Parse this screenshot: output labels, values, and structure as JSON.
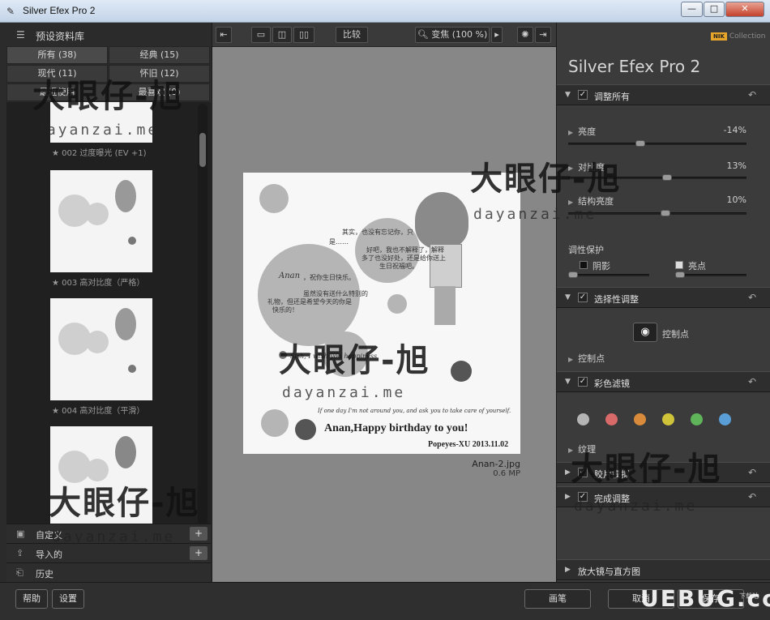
{
  "window": {
    "title": "Silver Efex Pro 2",
    "min": "0",
    "max": "1",
    "close": "r"
  },
  "library": {
    "title": "预设资料库",
    "tabs": [
      {
        "label": "所有 (38)"
      },
      {
        "label": "经典 (15)"
      },
      {
        "label": "现代 (11)"
      },
      {
        "label": "怀旧 (12)"
      },
      {
        "label": "最近使用"
      },
      {
        "label": "最喜欢 (0)"
      }
    ],
    "presets": [
      {
        "caption": "★ 002 过度曝光 (EV +1)"
      },
      {
        "caption": "★ 003 高对比度（严格）"
      },
      {
        "caption": "★ 004 高对比度（平滑）"
      },
      {
        "caption": ""
      }
    ],
    "rows": [
      {
        "label": "自定义",
        "plus": "+"
      },
      {
        "label": "导入的",
        "plus": "+"
      },
      {
        "label": "历史"
      }
    ]
  },
  "toolbar": {
    "compare_label": "比较",
    "zoom_label": "变焦 (100 %)"
  },
  "photo": {
    "line1": "其实，也没有忘记你，只",
    "line2": "是……",
    "line3": "好吧，我也不解释了，解释",
    "line4": "多了也没好处，还是给你送上",
    "line5": "生日祝福吧。",
    "anan": "Anan",
    "greet": "，祝你生日快乐。",
    "line6": "虽然没有送什么特别的",
    "line7": "礼物，但还是希望今天的你是",
    "line8": "快乐的！",
    "script1": "Sish, I wish you happiness",
    "script2": "If one day I'm not around you, and ask you to take care of yourself.",
    "birthday": "Anan,Happy birthday to you!",
    "signature": "Popeyes-XU 2013.11.02"
  },
  "file": {
    "name": "Anan-2.jpg",
    "size": "0.6 MP"
  },
  "panel": {
    "brand": "Collection",
    "brand_badge": "NIK",
    "product": "Silver Efex Pro",
    "product_version": "2",
    "adjust_all": "调整所有",
    "sliders": [
      {
        "label": "亮度",
        "value": "-14%",
        "pos": 0.4
      },
      {
        "label": "对比度",
        "value": "13%",
        "pos": 0.56
      },
      {
        "label": "结构亮度",
        "value": "10%",
        "pos": 0.55
      }
    ],
    "tonal_protection": "调性保护",
    "shadows": "阴影",
    "highlights": "亮点",
    "selective": "选择性调整",
    "control_point_btn": "控制点",
    "control_points": "控制点",
    "color_filter": "彩色滤镜",
    "filter_colors": [
      "#b4b4b4",
      "#d86a6a",
      "#d98a3a",
      "#cfc33a",
      "#5fb45a",
      "#5a9ed8"
    ],
    "grain": "纹理",
    "film": "胶片模拟",
    "finishing": "完成调整",
    "loupe": "放大镜与直方图"
  },
  "bottom": {
    "help": "帮助",
    "settings": "设置",
    "brush": "画笔",
    "cancel": "取消",
    "save": "保存"
  },
  "watermark": {
    "text": "大眼仔-旭",
    "site": "dayanzai.me",
    "ulbug": "UEBUG.com",
    "ulbug_sub": "下载站"
  }
}
